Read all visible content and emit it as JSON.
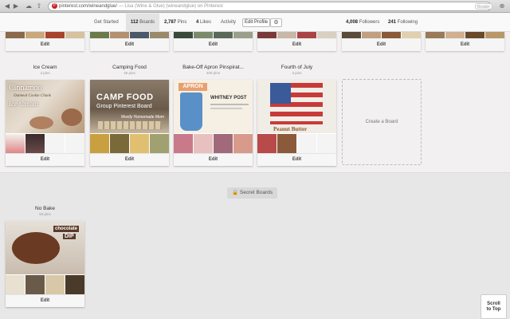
{
  "browser": {
    "url_host": "pinterest.com",
    "url_path": "/wineandglue/",
    "page_title": "Lisa (Wine & Glue) (wineandglue) on Pinterest",
    "reader_label": "Reader",
    "back_icon": "back-arrow-icon",
    "forward_icon": "forward-arrow-icon"
  },
  "profile_nav": {
    "get_started": "Get Started",
    "boards_count": "112",
    "boards_label": "Boards",
    "pins_count": "2,787",
    "pins_label": "Pins",
    "likes_count": "4",
    "likes_label": "Likes",
    "activity": "Activity",
    "edit_profile": "Edit Profile",
    "followers_count": "4,008",
    "followers_label": "Followers",
    "following_count": "241",
    "following_label": "Following"
  },
  "partial_row": {
    "edit_label": "Edit"
  },
  "boards": [
    {
      "title": "Ice Cream",
      "pins": "3 pins",
      "cover_line1": "Cinnamon",
      "cover_line2": "Oatmeal Cookie Chunk",
      "cover_line3": "Ice Cream",
      "edit": "Edit"
    },
    {
      "title": "Camping Food",
      "pins": "46 pins",
      "cover_line1": "CAMP FOOD",
      "cover_line2": "Group Pinterest Board",
      "cover_line3": "Mostly Homemade Mom",
      "edit": "Edit"
    },
    {
      "title": "Bake-Off Apron Pinspirat...",
      "pins": "400 pins",
      "cover_line1": "APRON",
      "cover_line2": "WHITNEY POST",
      "edit": "Edit"
    },
    {
      "title": "Fourth of July",
      "pins": "3 pins",
      "cover_line1": "Peanut Butter",
      "edit": "Edit"
    }
  ],
  "create_board": "Create a Board",
  "secret_boards_label": "Secret Boards",
  "secret_boards": [
    {
      "title": "No Bake",
      "pins": "93 pins",
      "cover_line1": "chocolate",
      "cover_line2": "DIP",
      "edit": "Edit"
    }
  ],
  "scroll_to_top_line1": "Scroll",
  "scroll_to_top_line2": "to Top"
}
